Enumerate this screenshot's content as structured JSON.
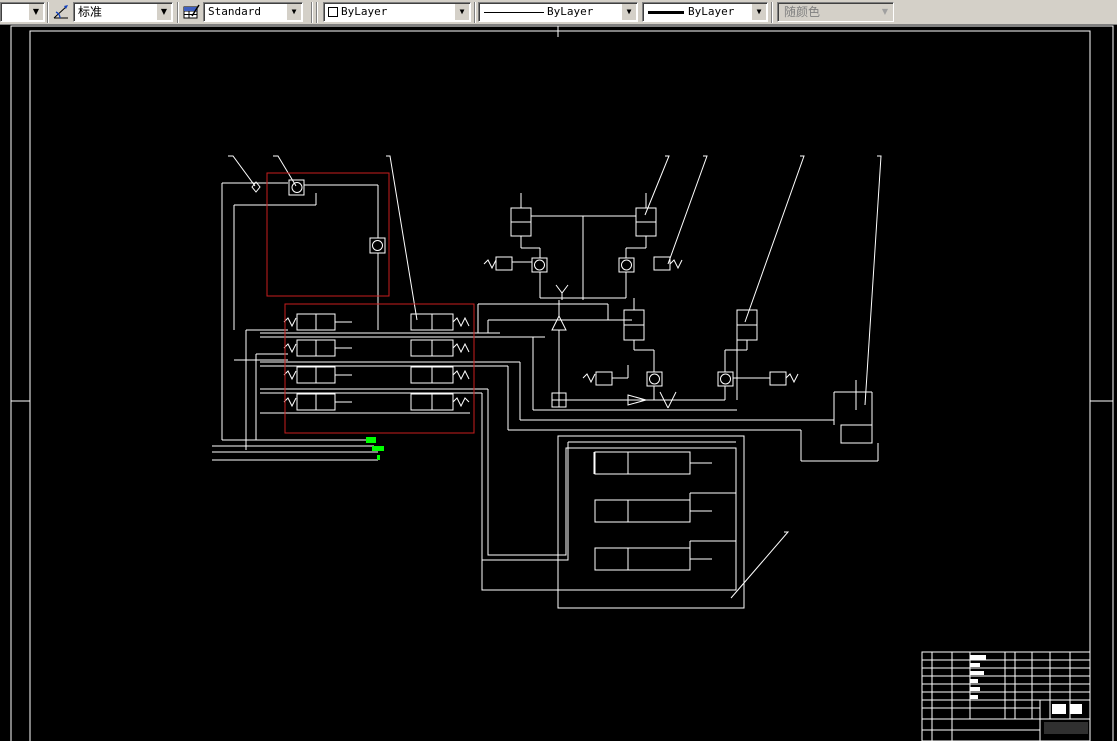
{
  "toolbar": {
    "dim_style": "标准",
    "table_style": "Standard",
    "color": "ByLayer",
    "linetype": "ByLayer",
    "lineweight": "ByLayer",
    "plot_style": "随颜色"
  },
  "icons": [
    "dropdown-arrow-icon",
    "dimension-style-icon",
    "table-style-icon"
  ],
  "colors": {
    "background": "#000000",
    "lines": "#ffffff",
    "highlight_box": "#c81e1e",
    "green_marker": "#00ff00",
    "toolbar": "#d4d0c8"
  }
}
